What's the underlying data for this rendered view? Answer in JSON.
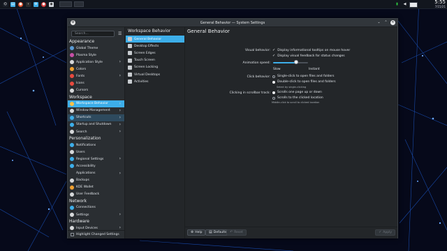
{
  "colors": {
    "accent": "#3daee9",
    "window_bg": "#232629",
    "sidebar_bg": "#2a2e32"
  },
  "panel": {
    "clock_time": "5:55",
    "clock_date": "7/15/21",
    "clock_suffix": "PM",
    "tray_icons": [
      "launcher-icon",
      "file-manager-icon",
      "browser-icon",
      "terminal-icon",
      "settings-icon"
    ]
  },
  "window": {
    "title": "General Behavior — System Settings",
    "buttons": [
      "minimize",
      "maximize",
      "close"
    ]
  },
  "sidebar": {
    "search_placeholder": "Search...",
    "categories": [
      {
        "header": "Appearance",
        "items": [
          {
            "label": "Global Theme",
            "icon": "global-theme-icon",
            "color": "#5a9bd5",
            "chevron": false
          },
          {
            "label": "Plasma Style",
            "icon": "plasma-style-icon",
            "color": "#c84fa6",
            "chevron": false
          },
          {
            "label": "Application Style",
            "icon": "application-style-icon",
            "color": "#d6d8da",
            "chevron": true
          },
          {
            "label": "Colors",
            "icon": "colors-icon",
            "color": "#f0a030",
            "chevron": false
          },
          {
            "label": "Fonts",
            "icon": "fonts-icon",
            "color": "#e84a3f",
            "chevron": true
          },
          {
            "label": "Icons",
            "icon": "icons-icon",
            "color": "#e84a3f",
            "chevron": false
          },
          {
            "label": "Cursors",
            "icon": "cursors-icon",
            "color": "#d6d8da",
            "chevron": false
          }
        ]
      },
      {
        "header": "Workspace",
        "items": [
          {
            "label": "Workspace Behavior",
            "icon": "workspace-behavior-icon",
            "color": "#f5c04a",
            "chevron": true,
            "selected": true
          },
          {
            "label": "Window Management",
            "icon": "window-management-icon",
            "color": "#d6d8da",
            "chevron": true
          },
          {
            "label": "Shortcuts",
            "icon": "shortcuts-icon",
            "color": "#3daee9",
            "chevron": true,
            "hover": true
          },
          {
            "label": "Startup and Shutdown",
            "icon": "startup-shutdown-icon",
            "color": "#3daee9",
            "chevron": true
          },
          {
            "label": "Search",
            "icon": "search-settings-icon",
            "color": "#d6d8da",
            "chevron": true
          }
        ]
      },
      {
        "header": "Personalization",
        "items": [
          {
            "label": "Notifications",
            "icon": "notifications-icon",
            "color": "#3daee9",
            "chevron": false
          },
          {
            "label": "Users",
            "icon": "users-icon",
            "color": "#d6d8da",
            "chevron": false
          },
          {
            "label": "Regional Settings",
            "icon": "regional-settings-icon",
            "color": "#3daee9",
            "chevron": true
          },
          {
            "label": "Accessibility",
            "icon": "accessibility-icon",
            "color": "#3daee9",
            "chevron": false
          },
          {
            "label": "Applications",
            "icon": "applications-icon",
            "color": "#d6d8da",
            "chevron": true,
            "sub": true
          },
          {
            "label": "Backups",
            "icon": "backups-icon",
            "color": "#d6d8da",
            "chevron": false
          },
          {
            "label": "KDE Wallet",
            "icon": "kde-wallet-icon",
            "color": "#f0a030",
            "chevron": false
          },
          {
            "label": "User Feedback",
            "icon": "user-feedback-icon",
            "color": "#d6d8da",
            "chevron": false
          }
        ]
      },
      {
        "header": "Network",
        "items": [
          {
            "label": "Connections",
            "icon": "connections-icon",
            "color": "#3daee9",
            "chevron": false
          },
          {
            "label": "Settings",
            "icon": "network-settings-icon",
            "color": "#d6d8da",
            "chevron": true
          }
        ]
      },
      {
        "header": "Hardware",
        "items": [
          {
            "label": "Input Devices",
            "icon": "input-devices-icon",
            "color": "#d6d8da",
            "chevron": true
          }
        ]
      }
    ],
    "highlight_label": "Highlight Changed Settings"
  },
  "subpane": {
    "title": "Workspace Behavior",
    "items": [
      {
        "label": "General Behavior",
        "selected": true
      },
      {
        "label": "Desktop Effects"
      },
      {
        "label": "Screen Edges"
      },
      {
        "label": "Touch Screen"
      },
      {
        "label": "Screen Locking"
      },
      {
        "label": "Virtual Desktops"
      },
      {
        "label": "Activities"
      }
    ]
  },
  "main": {
    "title": "General Behavior",
    "visual_label": "Visual behavior:",
    "visual_opt1": "Display informational tooltips on mouse hover",
    "visual_opt2": "Display visual feedback for status changes",
    "anim_label": "Animation speed:",
    "anim_slow": "Slow",
    "anim_instant": "Instant",
    "anim_value": 0.65,
    "click_label": "Click behavior:",
    "click_opt1": "Single-click to open files and folders",
    "click_opt2": "Double-click to open files and folders",
    "click_hint": "Select by single-clicking",
    "click_selected": 2,
    "scroll_label": "Clicking in scrollbar track:",
    "scroll_opt1": "Scrolls one page up or down",
    "scroll_opt2": "Scrolls to the clicked location",
    "scroll_hint": "Middle-click to scroll to clicked location",
    "scroll_selected": 1
  },
  "bottom": {
    "help": "Help",
    "defaults": "Defaults",
    "reset": "Reset",
    "apply": "Apply"
  }
}
